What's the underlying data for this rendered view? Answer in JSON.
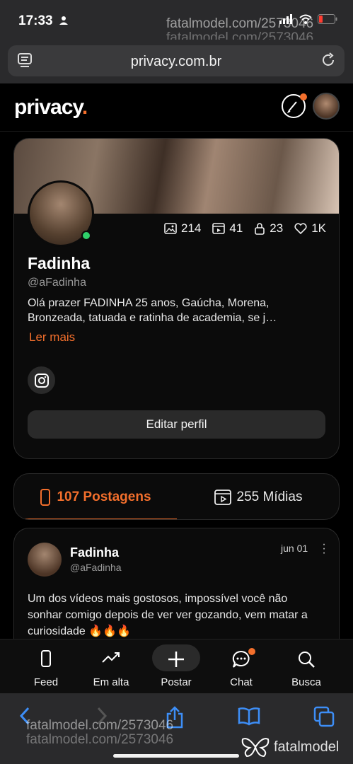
{
  "status_bar": {
    "time": "17:33"
  },
  "watermark": {
    "line1": "fatalmodel.com/2573046",
    "line2": "fatalmodel.com/2573046",
    "brand": "fatalmodel"
  },
  "browser": {
    "url": "privacy.com.br"
  },
  "header": {
    "logo": "privacy",
    "logo_dot": "."
  },
  "profile": {
    "name": "Fadinha",
    "handle": "@aFadinha",
    "bio": "Olá prazer FADINHA 25 anos, Gaúcha, Morena, Bronzeada, tatuada e ratinha de academia, se j…",
    "read_more": "Ler mais",
    "stats": {
      "photos": "214",
      "videos": "41",
      "locked": "23",
      "likes": "1K"
    },
    "edit_label": "Editar perfil"
  },
  "tabs": [
    {
      "label": "107 Postagens",
      "active": true
    },
    {
      "label": "255 Mídias",
      "active": false
    }
  ],
  "post": {
    "name": "Fadinha",
    "handle": "@aFadinha",
    "date": "jun 01",
    "text": "Um dos vídeos mais gostosos, impossível você não sonhar comigo depois de ver ver gozando, vem matar a curiosidade 🔥🔥🔥"
  },
  "bottom_nav": [
    {
      "label": "Feed",
      "icon": "phone-icon"
    },
    {
      "label": "Em alta",
      "icon": "trending-icon"
    },
    {
      "label": "Postar",
      "icon": "plus-icon"
    },
    {
      "label": "Chat",
      "icon": "chat-icon"
    },
    {
      "label": "Busca",
      "icon": "search-icon"
    }
  ],
  "colors": {
    "accent": "#f36f2c",
    "online": "#2fd06a",
    "background": "#000000",
    "safari_blue": "#3d8ef7"
  }
}
